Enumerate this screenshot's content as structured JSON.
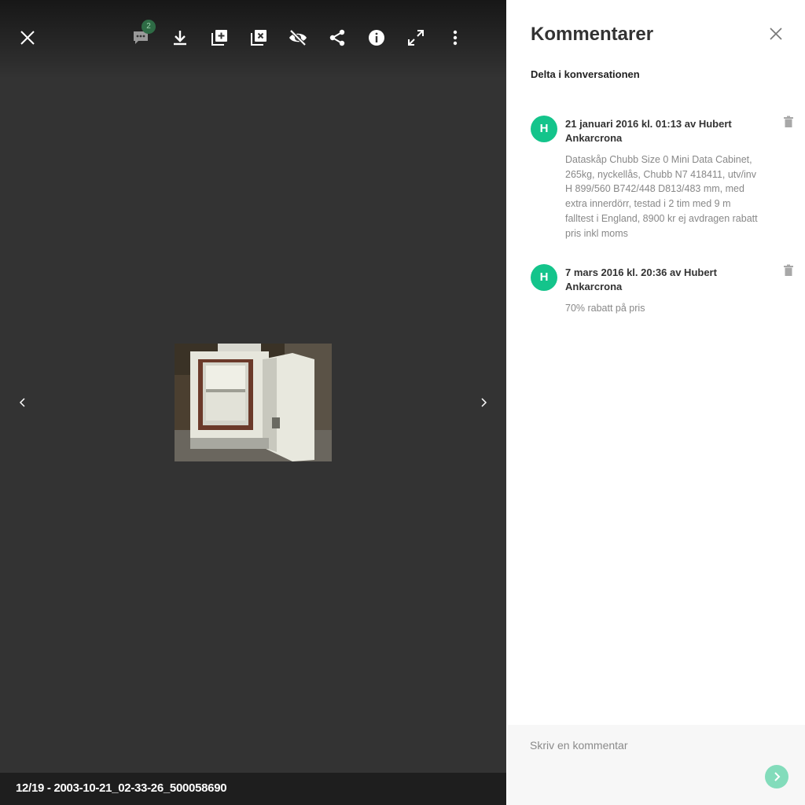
{
  "viewer": {
    "toolbar": {
      "close_icon": "close-icon",
      "comments_icon": "comments-icon",
      "comments_badge": "2",
      "download_icon": "download-icon",
      "add_to_album_icon": "add-to-album-icon",
      "remove_from_album_icon": "remove-from-album-icon",
      "hide_icon": "hide-icon",
      "share_icon": "share-icon",
      "info_icon": "info-icon",
      "fullscreen_icon": "fullscreen-icon",
      "more_icon": "more-vertical-icon"
    },
    "caption": "12/19 - 2003-10-21_02-33-26_500058690"
  },
  "comments_panel": {
    "title": "Kommentarer",
    "subtitle": "Delta i konversationen",
    "comments": [
      {
        "avatar_letter": "H",
        "header": "21 januari 2016 kl. 01:13 av Hubert Ankarcrona",
        "body": "Dataskåp Chubb Size 0 Mini Data Cabinet, 265kg, nyckellås, Chubb N7 418411, utv/inv H 899/560 B742/448 D813/483 mm, med extra innerdörr, testad i 2 tim med 9 m falltest i England, 8900 kr ej avdragen rabatt pris inkl moms"
      },
      {
        "avatar_letter": "H",
        "header": "7 mars 2016 kl. 20:36 av Hubert Ankarcrona",
        "body": "70% rabatt på pris"
      }
    ],
    "compose": {
      "placeholder": "Skriv en kommentar"
    }
  },
  "colors": {
    "viewer_bg": "#333333",
    "avatar": "#14c48b",
    "send_button": "#83dcbb"
  }
}
